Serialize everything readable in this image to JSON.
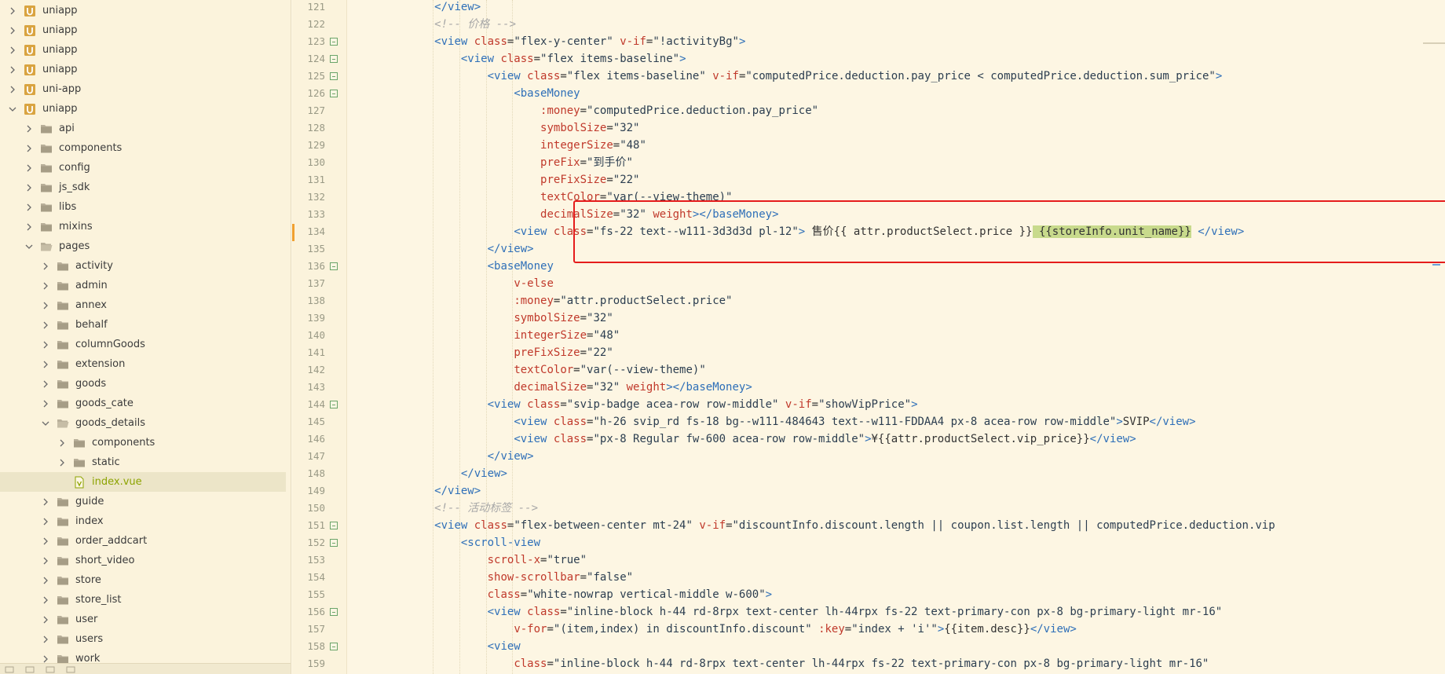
{
  "sidebar": {
    "items": [
      {
        "label": "uniapp",
        "type": "project",
        "depth": 0,
        "expanded": false,
        "selected": false
      },
      {
        "label": "uniapp",
        "type": "project",
        "depth": 0,
        "expanded": false,
        "selected": false
      },
      {
        "label": "uniapp",
        "type": "project",
        "depth": 0,
        "expanded": false,
        "selected": false
      },
      {
        "label": "uniapp",
        "type": "project",
        "depth": 0,
        "expanded": false,
        "selected": false
      },
      {
        "label": "uni-app",
        "type": "project",
        "depth": 0,
        "expanded": false,
        "selected": false
      },
      {
        "label": "uniapp",
        "type": "project",
        "depth": 0,
        "expanded": true,
        "selected": false
      },
      {
        "label": "api",
        "type": "folder",
        "depth": 1,
        "expanded": false,
        "selected": false
      },
      {
        "label": "components",
        "type": "folder",
        "depth": 1,
        "expanded": false,
        "selected": false
      },
      {
        "label": "config",
        "type": "folder",
        "depth": 1,
        "expanded": false,
        "selected": false
      },
      {
        "label": "js_sdk",
        "type": "folder",
        "depth": 1,
        "expanded": false,
        "selected": false
      },
      {
        "label": "libs",
        "type": "folder",
        "depth": 1,
        "expanded": false,
        "selected": false
      },
      {
        "label": "mixins",
        "type": "folder",
        "depth": 1,
        "expanded": false,
        "selected": false
      },
      {
        "label": "pages",
        "type": "folder",
        "depth": 1,
        "expanded": true,
        "selected": false
      },
      {
        "label": "activity",
        "type": "folder",
        "depth": 2,
        "expanded": false,
        "selected": false
      },
      {
        "label": "admin",
        "type": "folder",
        "depth": 2,
        "expanded": false,
        "selected": false
      },
      {
        "label": "annex",
        "type": "folder",
        "depth": 2,
        "expanded": false,
        "selected": false
      },
      {
        "label": "behalf",
        "type": "folder",
        "depth": 2,
        "expanded": false,
        "selected": false
      },
      {
        "label": "columnGoods",
        "type": "folder",
        "depth": 2,
        "expanded": false,
        "selected": false
      },
      {
        "label": "extension",
        "type": "folder",
        "depth": 2,
        "expanded": false,
        "selected": false
      },
      {
        "label": "goods",
        "type": "folder",
        "depth": 2,
        "expanded": false,
        "selected": false
      },
      {
        "label": "goods_cate",
        "type": "folder",
        "depth": 2,
        "expanded": false,
        "selected": false
      },
      {
        "label": "goods_details",
        "type": "folder",
        "depth": 2,
        "expanded": true,
        "selected": false
      },
      {
        "label": "components",
        "type": "folder",
        "depth": 3,
        "expanded": false,
        "selected": false
      },
      {
        "label": "static",
        "type": "folder",
        "depth": 3,
        "expanded": false,
        "selected": false
      },
      {
        "label": "index.vue",
        "type": "vue-file",
        "depth": 3,
        "expanded": false,
        "selected": true
      },
      {
        "label": "guide",
        "type": "folder",
        "depth": 2,
        "expanded": false,
        "selected": false
      },
      {
        "label": "index",
        "type": "folder",
        "depth": 2,
        "expanded": false,
        "selected": false
      },
      {
        "label": "order_addcart",
        "type": "folder",
        "depth": 2,
        "expanded": false,
        "selected": false
      },
      {
        "label": "short_video",
        "type": "folder",
        "depth": 2,
        "expanded": false,
        "selected": false
      },
      {
        "label": "store",
        "type": "folder",
        "depth": 2,
        "expanded": false,
        "selected": false
      },
      {
        "label": "store_list",
        "type": "folder",
        "depth": 2,
        "expanded": false,
        "selected": false
      },
      {
        "label": "user",
        "type": "folder",
        "depth": 2,
        "expanded": false,
        "selected": false
      },
      {
        "label": "users",
        "type": "folder",
        "depth": 2,
        "expanded": false,
        "selected": false
      },
      {
        "label": "work",
        "type": "folder",
        "depth": 2,
        "expanded": false,
        "selected": false
      }
    ]
  },
  "editor": {
    "current_line": 134,
    "lines": [
      {
        "n": "121",
        "fold": false,
        "indent": 12,
        "tokens": [
          [
            "tag",
            "</view>"
          ]
        ]
      },
      {
        "n": "122",
        "fold": false,
        "indent": 12,
        "tokens": [
          [
            "cmt",
            "<!-- 价格 -->"
          ]
        ]
      },
      {
        "n": "123",
        "fold": true,
        "indent": 12,
        "tokens": [
          [
            "tag",
            "<view "
          ],
          [
            "attr",
            "class"
          ],
          [
            "txt",
            "="
          ],
          [
            "str",
            "\"flex-y-center\""
          ],
          [
            "txt",
            " "
          ],
          [
            "attr",
            "v-if"
          ],
          [
            "txt",
            "="
          ],
          [
            "str",
            "\"!activityBg\""
          ],
          [
            "tag",
            ">"
          ]
        ]
      },
      {
        "n": "124",
        "fold": true,
        "indent": 16,
        "tokens": [
          [
            "tag",
            "<view "
          ],
          [
            "attr",
            "class"
          ],
          [
            "txt",
            "="
          ],
          [
            "str",
            "\"flex items-baseline\""
          ],
          [
            "tag",
            ">"
          ]
        ]
      },
      {
        "n": "125",
        "fold": true,
        "indent": 20,
        "tokens": [
          [
            "tag",
            "<view "
          ],
          [
            "attr",
            "class"
          ],
          [
            "txt",
            "="
          ],
          [
            "str",
            "\"flex items-baseline\""
          ],
          [
            "txt",
            " "
          ],
          [
            "attr",
            "v-if"
          ],
          [
            "txt",
            "="
          ],
          [
            "str",
            "\"computedPrice.deduction.pay_price < computedPrice.deduction.sum_price\""
          ],
          [
            "tag",
            ">"
          ]
        ]
      },
      {
        "n": "126",
        "fold": true,
        "indent": 24,
        "tokens": [
          [
            "tag",
            "<baseMoney"
          ]
        ]
      },
      {
        "n": "127",
        "fold": false,
        "indent": 28,
        "tokens": [
          [
            "attr",
            ":money"
          ],
          [
            "txt",
            "="
          ],
          [
            "str",
            "\"computedPrice.deduction.pay_price\""
          ]
        ]
      },
      {
        "n": "128",
        "fold": false,
        "indent": 28,
        "tokens": [
          [
            "attr",
            "symbolSize"
          ],
          [
            "txt",
            "="
          ],
          [
            "str",
            "\"32\""
          ]
        ]
      },
      {
        "n": "129",
        "fold": false,
        "indent": 28,
        "tokens": [
          [
            "attr",
            "integerSize"
          ],
          [
            "txt",
            "="
          ],
          [
            "str",
            "\"48\""
          ]
        ]
      },
      {
        "n": "130",
        "fold": false,
        "indent": 28,
        "tokens": [
          [
            "attr",
            "preFix"
          ],
          [
            "txt",
            "="
          ],
          [
            "str",
            "\"到手价\""
          ]
        ]
      },
      {
        "n": "131",
        "fold": false,
        "indent": 28,
        "tokens": [
          [
            "attr",
            "preFixSize"
          ],
          [
            "txt",
            "="
          ],
          [
            "str",
            "\"22\""
          ]
        ]
      },
      {
        "n": "132",
        "fold": false,
        "indent": 28,
        "tokens": [
          [
            "attr",
            "textColor"
          ],
          [
            "txt",
            "="
          ],
          [
            "str",
            "\"var(--view-theme)\""
          ]
        ]
      },
      {
        "n": "133",
        "fold": false,
        "indent": 28,
        "tokens": [
          [
            "attr",
            "decimalSize"
          ],
          [
            "txt",
            "="
          ],
          [
            "str",
            "\"32\""
          ],
          [
            "txt",
            " "
          ],
          [
            "attr",
            "weight"
          ],
          [
            "tag",
            "></baseMoney>"
          ]
        ]
      },
      {
        "n": "134",
        "fold": false,
        "indent": 24,
        "tokens": [
          [
            "tag",
            "<view "
          ],
          [
            "attr",
            "class"
          ],
          [
            "txt",
            "="
          ],
          [
            "str",
            "\"fs-22 text--w111-3d3d3d pl-12\""
          ],
          [
            "tag",
            ">"
          ],
          [
            "txt",
            " 售价{{ attr.productSelect.price }}"
          ],
          [
            "hl",
            " {{storeInfo.unit_name}}"
          ],
          [
            "txt",
            " "
          ],
          [
            "tag",
            "</view>"
          ]
        ]
      },
      {
        "n": "135",
        "fold": false,
        "indent": 20,
        "tokens": [
          [
            "tag",
            "</view>"
          ]
        ]
      },
      {
        "n": "136",
        "fold": true,
        "indent": 20,
        "tokens": [
          [
            "tag",
            "<baseMoney"
          ]
        ]
      },
      {
        "n": "137",
        "fold": false,
        "indent": 24,
        "tokens": [
          [
            "attr",
            "v-else"
          ]
        ]
      },
      {
        "n": "138",
        "fold": false,
        "indent": 24,
        "tokens": [
          [
            "attr",
            ":money"
          ],
          [
            "txt",
            "="
          ],
          [
            "str",
            "\"attr.productSelect.price\""
          ]
        ]
      },
      {
        "n": "139",
        "fold": false,
        "indent": 24,
        "tokens": [
          [
            "attr",
            "symbolSize"
          ],
          [
            "txt",
            "="
          ],
          [
            "str",
            "\"32\""
          ]
        ]
      },
      {
        "n": "140",
        "fold": false,
        "indent": 24,
        "tokens": [
          [
            "attr",
            "integerSize"
          ],
          [
            "txt",
            "="
          ],
          [
            "str",
            "\"48\""
          ]
        ]
      },
      {
        "n": "141",
        "fold": false,
        "indent": 24,
        "tokens": [
          [
            "attr",
            "preFixSize"
          ],
          [
            "txt",
            "="
          ],
          [
            "str",
            "\"22\""
          ]
        ]
      },
      {
        "n": "142",
        "fold": false,
        "indent": 24,
        "tokens": [
          [
            "attr",
            "textColor"
          ],
          [
            "txt",
            "="
          ],
          [
            "str",
            "\"var(--view-theme)\""
          ]
        ]
      },
      {
        "n": "143",
        "fold": false,
        "indent": 24,
        "tokens": [
          [
            "attr",
            "decimalSize"
          ],
          [
            "txt",
            "="
          ],
          [
            "str",
            "\"32\""
          ],
          [
            "txt",
            " "
          ],
          [
            "attr",
            "weight"
          ],
          [
            "tag",
            "></baseMoney>"
          ]
        ]
      },
      {
        "n": "144",
        "fold": true,
        "indent": 20,
        "tokens": [
          [
            "tag",
            "<view "
          ],
          [
            "attr",
            "class"
          ],
          [
            "txt",
            "="
          ],
          [
            "str",
            "\"svip-badge acea-row row-middle\""
          ],
          [
            "txt",
            " "
          ],
          [
            "attr",
            "v-if"
          ],
          [
            "txt",
            "="
          ],
          [
            "str",
            "\"showVipPrice\""
          ],
          [
            "tag",
            ">"
          ]
        ]
      },
      {
        "n": "145",
        "fold": false,
        "indent": 24,
        "tokens": [
          [
            "tag",
            "<view "
          ],
          [
            "attr",
            "class"
          ],
          [
            "txt",
            "="
          ],
          [
            "str",
            "\"h-26 svip_rd fs-18 bg--w111-484643 text--w111-FDDAA4 px-8 acea-row row-middle\""
          ],
          [
            "tag",
            ">"
          ],
          [
            "txt",
            "SVIP"
          ],
          [
            "tag",
            "</view>"
          ]
        ]
      },
      {
        "n": "146",
        "fold": false,
        "indent": 24,
        "tokens": [
          [
            "tag",
            "<view "
          ],
          [
            "attr",
            "class"
          ],
          [
            "txt",
            "="
          ],
          [
            "str",
            "\"px-8 Regular fw-600 acea-row row-middle\""
          ],
          [
            "tag",
            ">"
          ],
          [
            "txt",
            "¥{{attr.productSelect.vip_price}}"
          ],
          [
            "tag",
            "</view>"
          ]
        ]
      },
      {
        "n": "147",
        "fold": false,
        "indent": 20,
        "tokens": [
          [
            "tag",
            "</view>"
          ]
        ]
      },
      {
        "n": "148",
        "fold": false,
        "indent": 16,
        "tokens": [
          [
            "tag",
            "</view>"
          ]
        ]
      },
      {
        "n": "149",
        "fold": false,
        "indent": 12,
        "tokens": [
          [
            "tag",
            "</view>"
          ]
        ]
      },
      {
        "n": "150",
        "fold": false,
        "indent": 12,
        "tokens": [
          [
            "cmt",
            "<!-- 活动标签 -->"
          ]
        ]
      },
      {
        "n": "151",
        "fold": true,
        "indent": 12,
        "tokens": [
          [
            "tag",
            "<view "
          ],
          [
            "attr",
            "class"
          ],
          [
            "txt",
            "="
          ],
          [
            "str",
            "\"flex-between-center mt-24\""
          ],
          [
            "txt",
            " "
          ],
          [
            "attr",
            "v-if"
          ],
          [
            "txt",
            "="
          ],
          [
            "str",
            "\"discountInfo.discount.length || coupon.list.length || computedPrice.deduction.vip"
          ]
        ]
      },
      {
        "n": "152",
        "fold": true,
        "indent": 16,
        "tokens": [
          [
            "tag",
            "<scroll-view"
          ]
        ]
      },
      {
        "n": "153",
        "fold": false,
        "indent": 20,
        "tokens": [
          [
            "attr",
            "scroll-x"
          ],
          [
            "txt",
            "="
          ],
          [
            "str",
            "\"true\""
          ]
        ]
      },
      {
        "n": "154",
        "fold": false,
        "indent": 20,
        "tokens": [
          [
            "attr",
            "show-scrollbar"
          ],
          [
            "txt",
            "="
          ],
          [
            "str",
            "\"false\""
          ]
        ]
      },
      {
        "n": "155",
        "fold": false,
        "indent": 20,
        "tokens": [
          [
            "attr",
            "class"
          ],
          [
            "txt",
            "="
          ],
          [
            "str",
            "\"white-nowrap vertical-middle w-600\""
          ],
          [
            "tag",
            ">"
          ]
        ]
      },
      {
        "n": "156",
        "fold": true,
        "indent": 20,
        "tokens": [
          [
            "tag",
            "<view "
          ],
          [
            "attr",
            "class"
          ],
          [
            "txt",
            "="
          ],
          [
            "str",
            "\"inline-block h-44 rd-8rpx text-center lh-44rpx fs-22 text-primary-con px-8 bg-primary-light mr-16\""
          ]
        ]
      },
      {
        "n": "157",
        "fold": false,
        "indent": 24,
        "tokens": [
          [
            "attr",
            "v-for"
          ],
          [
            "txt",
            "="
          ],
          [
            "str",
            "\"(item,index) in discountInfo.discount\""
          ],
          [
            "txt",
            " "
          ],
          [
            "attr",
            ":key"
          ],
          [
            "txt",
            "="
          ],
          [
            "str",
            "\"index + 'i'\""
          ],
          [
            "tag",
            ">"
          ],
          [
            "txt",
            "{{item.desc}}"
          ],
          [
            "tag",
            "</view>"
          ]
        ]
      },
      {
        "n": "158",
        "fold": true,
        "indent": 20,
        "tokens": [
          [
            "tag",
            "<view"
          ]
        ]
      },
      {
        "n": "159",
        "fold": false,
        "indent": 24,
        "tokens": [
          [
            "attr",
            "class"
          ],
          [
            "txt",
            "="
          ],
          [
            "str",
            "\"inline-block h-44 rd-8rpx text-center lh-44rpx fs-22 text-primary-con px-8 bg-primary-light mr-16\""
          ]
        ]
      }
    ]
  },
  "icons": {
    "chevron_right": "chevron-right-icon",
    "chevron_down": "chevron-down-icon",
    "folder": "folder-icon",
    "project": "project-u-icon",
    "vue_file": "vue-file-icon"
  },
  "colors": {
    "highlight_box": "#e51c1c",
    "project_icon": "#d9a441",
    "folder_icon": "#b9b09a",
    "selected_text": "#8ca300"
  }
}
